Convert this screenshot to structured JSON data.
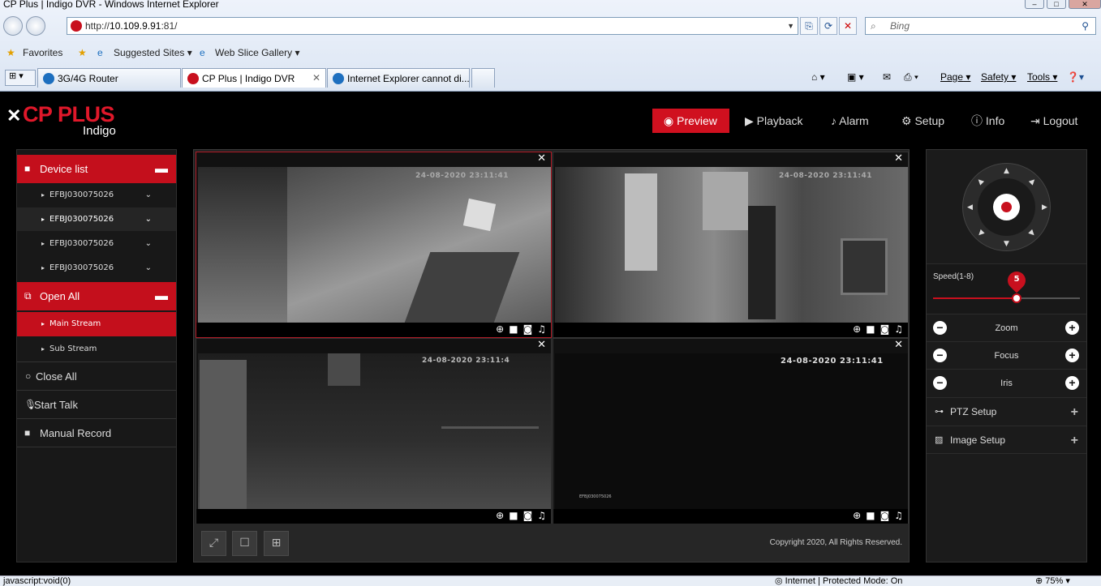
{
  "window": {
    "title": "CP Plus | Indigo DVR - Windows Internet Explorer"
  },
  "browser": {
    "url_scheme": "http://",
    "url_host": "10.109.9.91",
    "url_rest": ":81/",
    "search_placeholder": "Bing",
    "favorites_label": "Favorites",
    "suggested_sites": "Suggested Sites",
    "web_slice": "Web Slice Gallery",
    "tabs": [
      "3G/4G Router",
      "CP Plus | Indigo DVR",
      "Internet Explorer cannot di..."
    ],
    "commands": {
      "page": "Page",
      "safety": "Safety",
      "tools": "Tools"
    }
  },
  "app": {
    "brand": "CP PLUS",
    "brand_sub": "Indigo",
    "nav": [
      {
        "label": "Preview",
        "icon": "eye-icon"
      },
      {
        "label": "Playback",
        "icon": "play-icon"
      },
      {
        "label": "Alarm",
        "icon": "bell-icon"
      },
      {
        "label": "Setup",
        "icon": "gear-icon"
      },
      {
        "label": "Info",
        "icon": "info-icon"
      },
      {
        "label": "Logout",
        "icon": "logout-icon"
      }
    ],
    "sidebar": {
      "device_list": "Device list",
      "devices": [
        "EFBJ030075026",
        "EFBJ030075026",
        "EFBJ030075026",
        "EFBJ030075026"
      ],
      "open_all": "Open All",
      "main_stream": "Main Stream",
      "sub_stream": "Sub Stream",
      "close_all": "Close All",
      "start_talk": "Start Talk",
      "manual_record": "Manual Record"
    },
    "panes": [
      {
        "timestamp": "24-08-2020 23:11:41"
      },
      {
        "timestamp": "24-08-2020 23:11:41"
      },
      {
        "timestamp": "24-08-2020 23:11:4"
      },
      {
        "timestamp": "24-08-2020 23:11:41",
        "channel": "EFBJ030075026"
      }
    ],
    "copyright": "Copyright 2020, All Rights Reserved.",
    "ptz": {
      "speed_label": "Speed(1-8)",
      "speed_value": "5",
      "speed_fraction": 0.57,
      "zoom": "Zoom",
      "focus": "Focus",
      "iris": "Iris",
      "ptz_setup": "PTZ Setup",
      "image_setup": "Image Setup"
    }
  },
  "statusbar": {
    "left": "javascript:void(0)",
    "zone": "Internet | Protected Mode: On",
    "zoom": "75%"
  },
  "colors": {
    "accent": "#c8101e",
    "panel": "#1b1b1b"
  }
}
